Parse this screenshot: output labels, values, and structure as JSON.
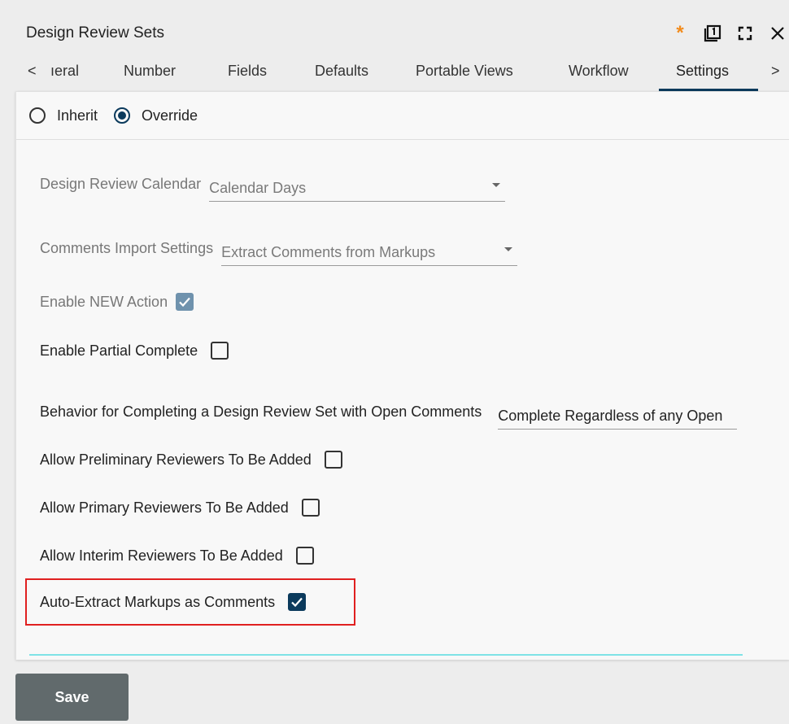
{
  "window": {
    "title": "Design Review Sets",
    "unsaved_marker": "*"
  },
  "tabs": {
    "prev": "<",
    "next": ">",
    "items": [
      {
        "label": "ıeral"
      },
      {
        "label": "Number"
      },
      {
        "label": "Fields"
      },
      {
        "label": "Defaults"
      },
      {
        "label": "Portable Views"
      },
      {
        "label": "Workflow"
      },
      {
        "label": "Settings",
        "active": true
      }
    ]
  },
  "mode": {
    "inherit_label": "Inherit",
    "override_label": "Override",
    "selected": "Override"
  },
  "settings": {
    "calendar": {
      "label": "Design Review Calendar",
      "value": "Calendar Days"
    },
    "comments_import": {
      "label": "Comments Import Settings",
      "value": "Extract Comments from Markups"
    },
    "enable_new_action": {
      "label": "Enable NEW Action",
      "checked": true,
      "disabled": true
    },
    "enable_partial_complete": {
      "label": "Enable Partial Complete",
      "checked": false
    },
    "behavior_open_comments": {
      "label": "Behavior for Completing a Design Review Set with Open Comments",
      "value": "Complete Regardless of any Open"
    },
    "allow_preliminary": {
      "label": "Allow Preliminary Reviewers To Be Added",
      "checked": false
    },
    "allow_primary": {
      "label": "Allow Primary Reviewers To Be Added",
      "checked": false
    },
    "allow_interim": {
      "label": "Allow Interim Reviewers To Be Added",
      "checked": false
    },
    "auto_extract": {
      "label": "Auto-Extract Markups as Comments",
      "checked": true
    }
  },
  "footer": {
    "save_label": "Save"
  },
  "colors": {
    "accent": "#0b3a5c",
    "unsaved": "#f28b1c",
    "highlight": "#e02020",
    "save_bg": "#616a6c"
  }
}
